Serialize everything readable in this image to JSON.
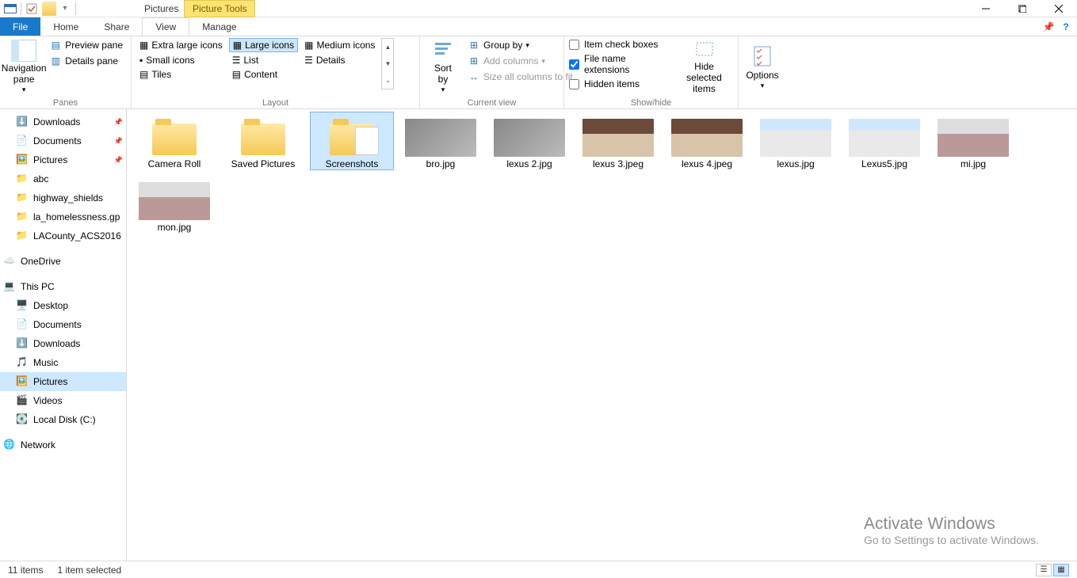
{
  "title": "Pictures",
  "picture_tools": "Picture Tools",
  "tabs": {
    "file": "File",
    "home": "Home",
    "share": "Share",
    "view": "View",
    "manage": "Manage"
  },
  "ribbon": {
    "panes": {
      "label": "Panes",
      "nav": "Navigation pane",
      "preview": "Preview pane",
      "details": "Details pane"
    },
    "layout": {
      "label": "Layout",
      "xl": "Extra large icons",
      "large": "Large icons",
      "medium": "Medium icons",
      "small": "Small icons",
      "list": "List",
      "details": "Details",
      "tiles": "Tiles",
      "content": "Content"
    },
    "currentview": {
      "label": "Current view",
      "sortby": "Sort by",
      "groupby": "Group by",
      "addcols": "Add columns",
      "sizecols": "Size all columns to fit"
    },
    "showhide": {
      "label": "Show/hide",
      "itemcheck": "Item check boxes",
      "ext": "File name extensions",
      "hidden": "Hidden items",
      "hidesel": "Hide selected items"
    },
    "options": "Options"
  },
  "nav": {
    "downloads": "Downloads",
    "documents": "Documents",
    "pictures": "Pictures",
    "abc": "abc",
    "highway": "highway_shields",
    "la_h": "la_homelessness.gp",
    "lac": "LACounty_ACS2016",
    "onedrive": "OneDrive",
    "thispc": "This PC",
    "desktop": "Desktop",
    "documents2": "Documents",
    "downloads2": "Downloads",
    "music": "Music",
    "pictures2": "Pictures",
    "videos": "Videos",
    "localdisk": "Local Disk (C:)",
    "network": "Network"
  },
  "items": [
    {
      "name": "Camera Roll",
      "type": "folder"
    },
    {
      "name": "Saved Pictures",
      "type": "folder"
    },
    {
      "name": "Screenshots",
      "type": "folder",
      "shots": true,
      "selected": true
    },
    {
      "name": "bro.jpg",
      "type": "img",
      "cls": ""
    },
    {
      "name": "lexus 2.jpg",
      "type": "img",
      "cls": ""
    },
    {
      "name": "lexus 3.jpeg",
      "type": "img",
      "cls": "int"
    },
    {
      "name": "lexus 4.jpeg",
      "type": "img",
      "cls": "int"
    },
    {
      "name": "lexus.jpg",
      "type": "img",
      "cls": "car"
    },
    {
      "name": "Lexus5.jpg",
      "type": "img",
      "cls": "car"
    },
    {
      "name": "mi.jpg",
      "type": "img",
      "cls": "desk"
    },
    {
      "name": "mon.jpg",
      "type": "img",
      "cls": "desk"
    }
  ],
  "status": {
    "count": "11 items",
    "sel": "1 item selected"
  },
  "watermark": {
    "t1": "Activate Windows",
    "t2": "Go to Settings to activate Windows."
  }
}
